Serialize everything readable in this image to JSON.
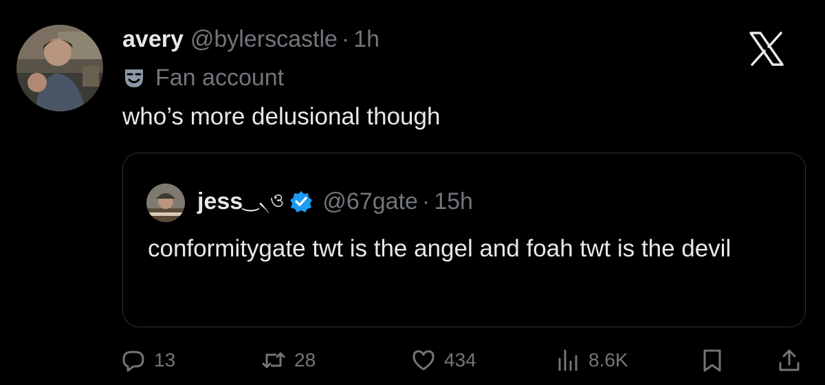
{
  "post": {
    "author_name": "avery",
    "author_handle": "@bylerscastle",
    "separator": "·",
    "time": "1h",
    "label": "Fan account",
    "text": "who’s more delusional though"
  },
  "quoted": {
    "author_name": "jess",
    "name_decoration": "‿৲ও",
    "author_handle": "@67gate",
    "separator": "·",
    "time": "15h",
    "text": "conformitygate twt is the angel and foah twt is the devil"
  },
  "actions": {
    "replies": "13",
    "reposts": "28",
    "likes": "434",
    "views": "8.6K"
  },
  "icons": {
    "brand": "x-logo-icon",
    "label": "theater-mask-icon",
    "verified": "verified-badge-icon",
    "reply": "reply-icon",
    "repost": "repost-icon",
    "like": "heart-icon",
    "views": "views-icon",
    "bookmark": "bookmark-icon",
    "share": "share-icon"
  },
  "colors": {
    "background": "#000000",
    "text_primary": "#e7e9ea",
    "text_secondary": "#71767b",
    "verified_blue": "#1d9bf0",
    "border": "#2f3336"
  }
}
